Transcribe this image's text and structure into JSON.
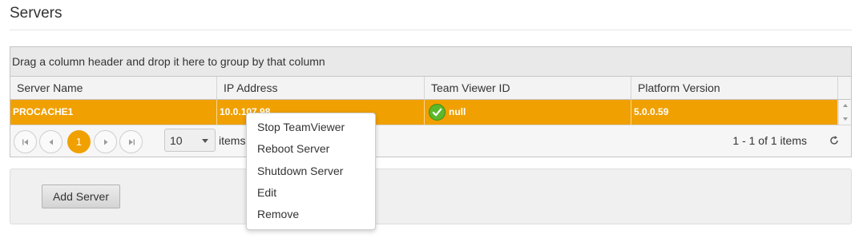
{
  "page": {
    "title": "Servers"
  },
  "grid": {
    "group_hint": "Drag a column header and drop it here to group by that column",
    "columns": [
      "Server Name",
      "IP Address",
      "Team Viewer ID",
      "Platform Version"
    ],
    "rows": [
      {
        "server_name": "PROCACHE1",
        "ip_address": "10.0.107.98",
        "team_viewer_id": "null",
        "platform_version": "5.0.0.59",
        "status_icon": "check-icon"
      }
    ],
    "selected_row_color": "#f0a000"
  },
  "pager": {
    "current_page": "1",
    "page_size": "10",
    "items_label": "items",
    "info": "1 - 1 of 1 items",
    "accent_color": "#f0a000"
  },
  "actions": {
    "add_server_label": "Add Server"
  },
  "context_menu": {
    "items": [
      "Stop TeamViewer",
      "Reboot Server",
      "Shutdown Server",
      "Edit",
      "Remove"
    ]
  }
}
